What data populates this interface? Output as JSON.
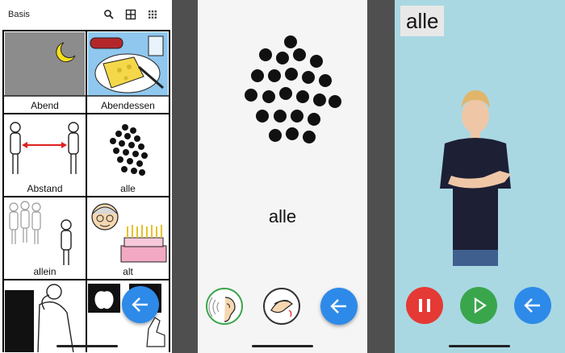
{
  "panel1": {
    "title": "Basis",
    "toolbar_icons": [
      "search-icon",
      "grid-large-icon",
      "grid-small-icon"
    ],
    "tiles": [
      {
        "label": "Abend",
        "icon": "moon-night"
      },
      {
        "label": "Abendessen",
        "icon": "dinner-plate"
      },
      {
        "label": "Abstand",
        "icon": "two-people-distance"
      },
      {
        "label": "alle",
        "icon": "many-dots"
      },
      {
        "label": "allein",
        "icon": "person-alone"
      },
      {
        "label": "alt",
        "icon": "old-person-cake"
      },
      {
        "label": "",
        "icon": "person-thinking"
      },
      {
        "label": "",
        "icon": "apple-pointing"
      }
    ],
    "back_icon": "arrow-left-icon"
  },
  "panel2": {
    "word": "alle",
    "symbol": "many-dots",
    "buttons": [
      "hear-icon",
      "sign-hands-icon",
      "arrow-left-icon"
    ]
  },
  "panel3": {
    "word": "alle",
    "video": "sign-language-video",
    "buttons": [
      "pause-icon",
      "play-icon",
      "arrow-left-icon"
    ],
    "colors": {
      "pause": "#e53935",
      "play": "#3aa64c",
      "back": "#2e8ae8"
    }
  }
}
